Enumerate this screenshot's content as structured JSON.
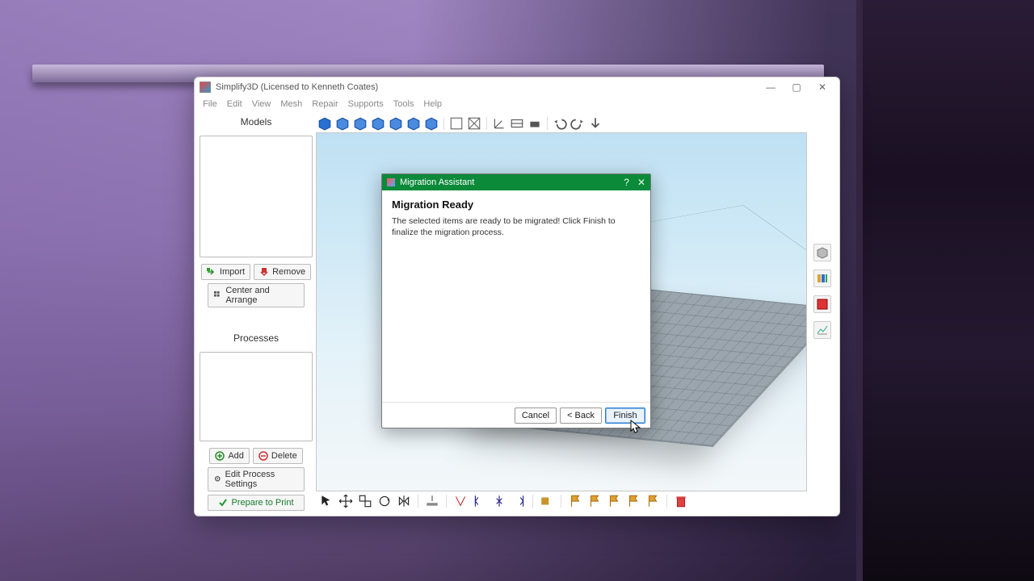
{
  "window": {
    "title": "Simplify3D (Licensed to Kenneth Coates)",
    "controls": {
      "min": "—",
      "max": "▢",
      "close": "✕"
    }
  },
  "menubar": [
    "File",
    "Edit",
    "View",
    "Mesh",
    "Repair",
    "Supports",
    "Tools",
    "Help"
  ],
  "left_panel": {
    "models_title": "Models",
    "processes_title": "Processes",
    "buttons": {
      "import": "Import",
      "remove": "Remove",
      "center_arrange": "Center and Arrange",
      "add": "Add",
      "delete": "Delete",
      "edit_process": "Edit Process Settings",
      "prepare": "Prepare to Print"
    }
  },
  "dialog": {
    "title": "Migration Assistant",
    "heading": "Migration Ready",
    "body": "The selected items are ready to be migrated!  Click Finish to finalize the migration process.",
    "help": "?",
    "close": "✕",
    "buttons": {
      "cancel": "Cancel",
      "back": "< Back",
      "finish": "Finish"
    }
  }
}
